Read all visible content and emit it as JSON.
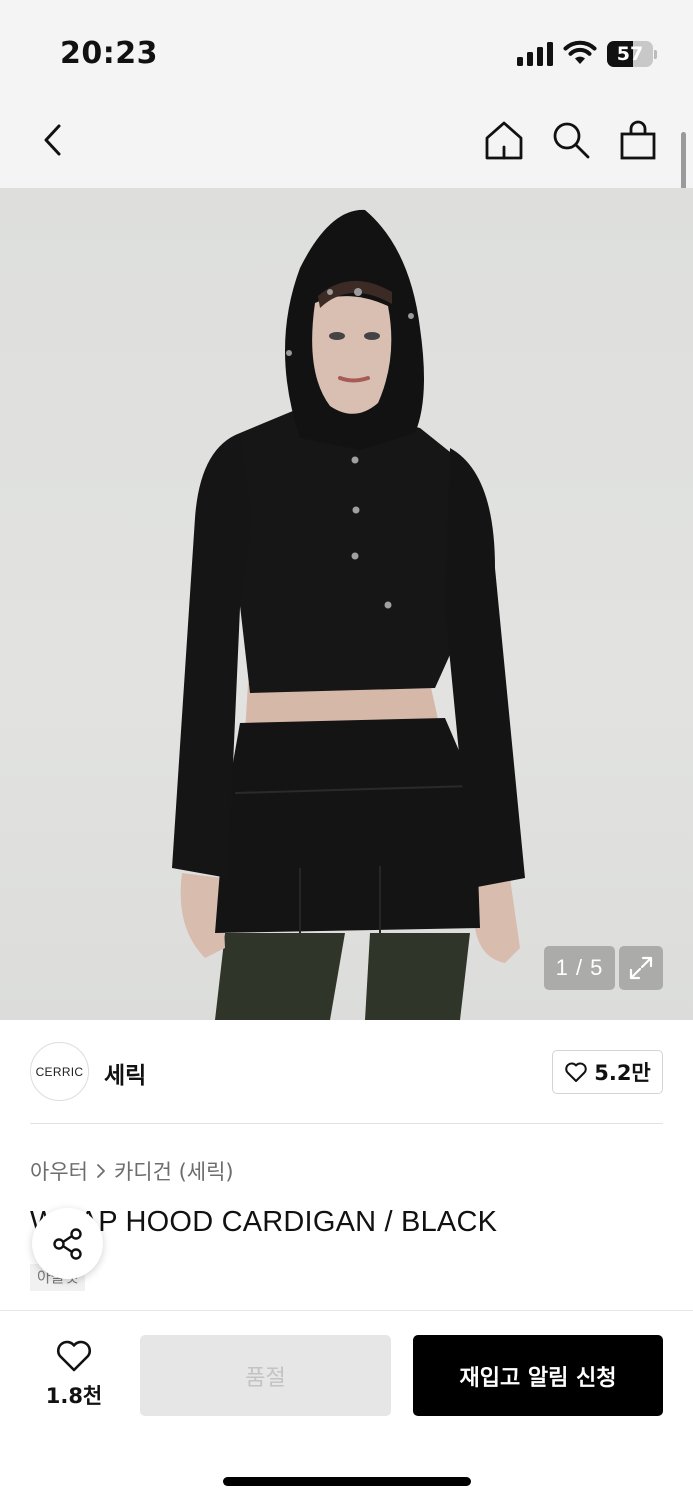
{
  "status_bar": {
    "time": "20:23",
    "battery_level": "57",
    "battery_fraction": 0.57
  },
  "nav": {
    "icons": [
      "back-chevron-icon",
      "home-icon",
      "search-icon",
      "shopping-bag-icon"
    ]
  },
  "gallery": {
    "pager": "1 / 5",
    "current": 1,
    "total": 5
  },
  "brand": {
    "logo_text": "CERRIC",
    "name": "세릭",
    "likes": "5.2만"
  },
  "product": {
    "breadcrumb": [
      "아우터",
      "카디건 (세릭)"
    ],
    "title": "WRAP HOOD CARDIGAN / BLACK",
    "tag": "아울렛"
  },
  "bottom_bar": {
    "wish_count": "1.8천",
    "soldout_label": "품절",
    "restock_label": "재입고 알림 신청"
  },
  "colors": {
    "accent": "#000000",
    "background": "#ffffff",
    "header_bg": "#f4f4f4",
    "disabled_bg": "#e6e6e6"
  }
}
